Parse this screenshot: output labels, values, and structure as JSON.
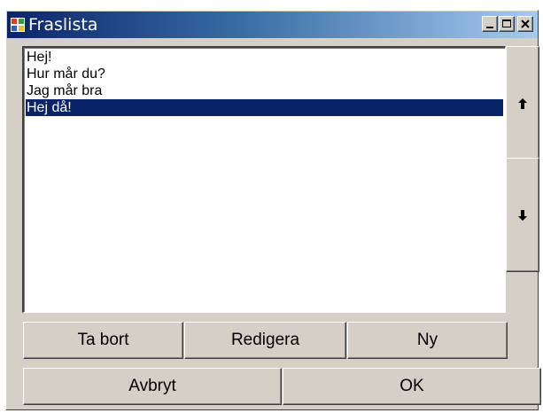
{
  "window": {
    "title": "Fraslista",
    "icon": "app-window-icon",
    "controls": {
      "minimize": "minimize-icon",
      "maximize": "maximize-icon",
      "close": "close-icon"
    }
  },
  "phrase_list": {
    "items": [
      {
        "label": "Hej!",
        "selected": false
      },
      {
        "label": "Hur mår du?",
        "selected": false
      },
      {
        "label": "Jag mår bra",
        "selected": false
      },
      {
        "label": "Hej då!",
        "selected": true
      }
    ],
    "selected_background": "#0a246a"
  },
  "move_buttons": {
    "up_icon": "arrow-up-icon",
    "down_icon": "arrow-down-icon"
  },
  "actions": {
    "delete_label": "Ta bort",
    "edit_label": "Redigera",
    "new_label": "Ny"
  },
  "dialog_buttons": {
    "cancel_label": "Avbryt",
    "ok_label": "OK"
  },
  "colors": {
    "face": "#d4d0c8",
    "titlebar_start": "#0a246a",
    "titlebar_end": "#a6caf0"
  }
}
